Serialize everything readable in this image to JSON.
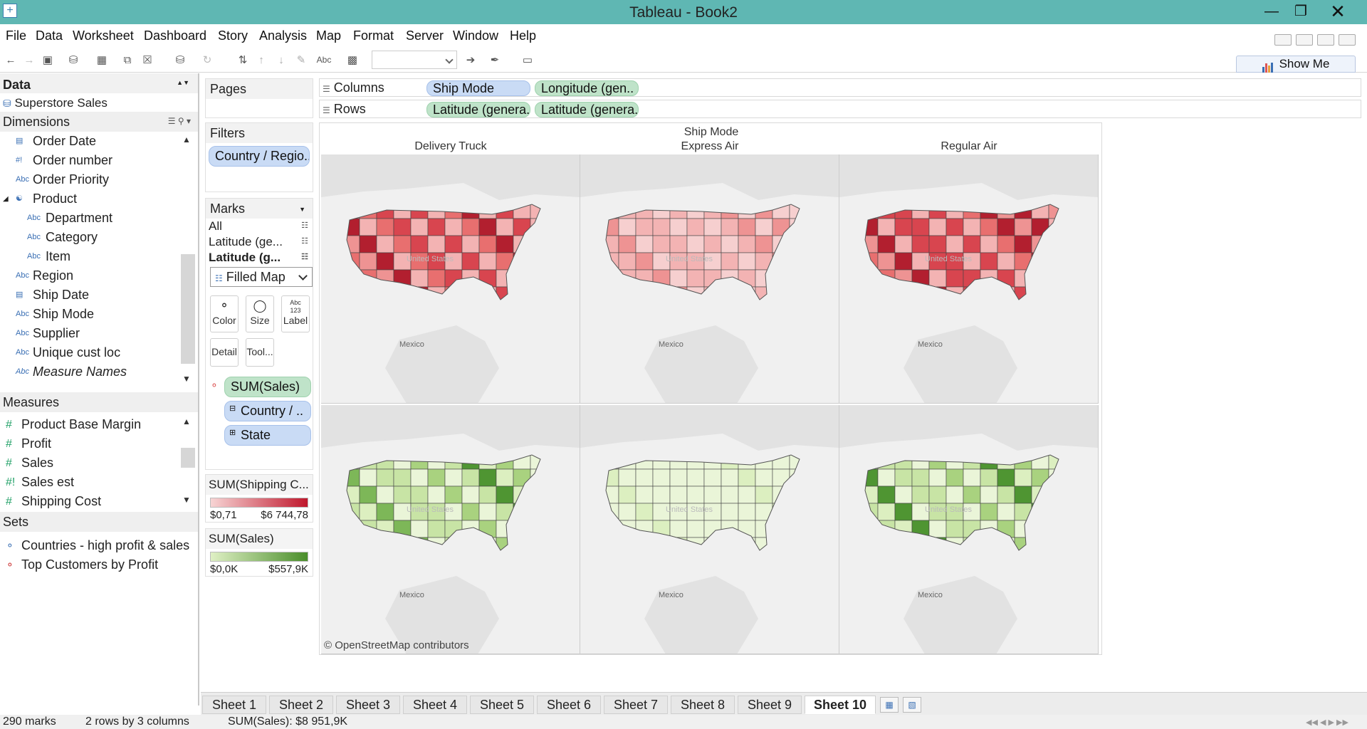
{
  "window": {
    "title": "Tableau - Book2"
  },
  "menu": [
    "File",
    "Data",
    "Worksheet",
    "Dashboard",
    "Story",
    "Analysis",
    "Map",
    "Format",
    "Server",
    "Window",
    "Help"
  ],
  "toolbar": {
    "abc_label": "Abc",
    "show_me": "Show Me"
  },
  "data_pane": {
    "header": "Data",
    "datasource": "Superstore Sales",
    "dimensions_header": "Dimensions",
    "dimensions": [
      {
        "label": "Order Date",
        "icon": "calendar-icon"
      },
      {
        "label": "Order number",
        "icon": "hash-icon"
      },
      {
        "label": "Order Priority",
        "icon": "abc-icon"
      },
      {
        "label": "Product",
        "icon": "hierarchy-icon"
      },
      {
        "label": "Department",
        "icon": "abc-icon"
      },
      {
        "label": "Category",
        "icon": "abc-icon"
      },
      {
        "label": "Item",
        "icon": "abc-icon"
      },
      {
        "label": "Region",
        "icon": "abc-icon"
      },
      {
        "label": "Ship Date",
        "icon": "calendar-icon"
      },
      {
        "label": "Ship Mode",
        "icon": "abc-icon"
      },
      {
        "label": "Supplier",
        "icon": "abc-icon"
      },
      {
        "label": "Unique cust loc",
        "icon": "abc-icon"
      },
      {
        "label": "Measure Names",
        "icon": "abc-icon"
      }
    ],
    "measures_header": "Measures",
    "measures": [
      "Product Base Margin",
      "Profit",
      "Sales",
      "Sales est",
      "Shipping Cost"
    ],
    "sets_header": "Sets",
    "sets": [
      "Countries - high profit & sales",
      "Top Customers by Profit"
    ]
  },
  "pages": {
    "title": "Pages"
  },
  "filters": {
    "title": "Filters",
    "pill": "Country / Regio.."
  },
  "marks": {
    "title": "Marks",
    "layers": [
      "All",
      "Latitude (ge...",
      "Latitude (g..."
    ],
    "type": "Filled Map",
    "buttons": {
      "color": "Color",
      "size": "Size",
      "label": "Label",
      "detail": "Detail",
      "tooltip": "Tool..."
    },
    "label_icon_text": {
      "abc": "Abc",
      "num": "123"
    },
    "pills": [
      "SUM(Sales)",
      "Country / ..",
      "State"
    ]
  },
  "legends": [
    {
      "title": "SUM(Shipping C...",
      "min": "$0,71",
      "max": "$6 744,78",
      "from": "#f7d4d4",
      "to": "#c0182d"
    },
    {
      "title": "SUM(Sales)",
      "min": "$0,0K",
      "max": "$557,9K",
      "from": "#dff0c4",
      "to": "#4a8e2b"
    }
  ],
  "shelves": {
    "columns_label": "Columns",
    "columns": [
      "Ship Mode",
      "Longitude (gen.."
    ],
    "rows_label": "Rows",
    "rows": [
      "Latitude (genera..",
      "Latitude (genera.."
    ]
  },
  "viz": {
    "header": "Ship Mode",
    "columns": [
      "Delivery Truck",
      "Express Air",
      "Regular Air"
    ],
    "map_labels": {
      "country": "United States",
      "mexico": "Mexico"
    },
    "attribution": "© OpenStreetMap contributors"
  },
  "tabs": [
    "Sheet 1",
    "Sheet 2",
    "Sheet 3",
    "Sheet 4",
    "Sheet 5",
    "Sheet 6",
    "Sheet 7",
    "Sheet 8",
    "Sheet 9",
    "Sheet 10"
  ],
  "active_tab": "Sheet 10",
  "status": {
    "marks": "290 marks",
    "grid": "2 rows by 3 columns",
    "sum": "SUM(Sales): $8 951,9K"
  }
}
